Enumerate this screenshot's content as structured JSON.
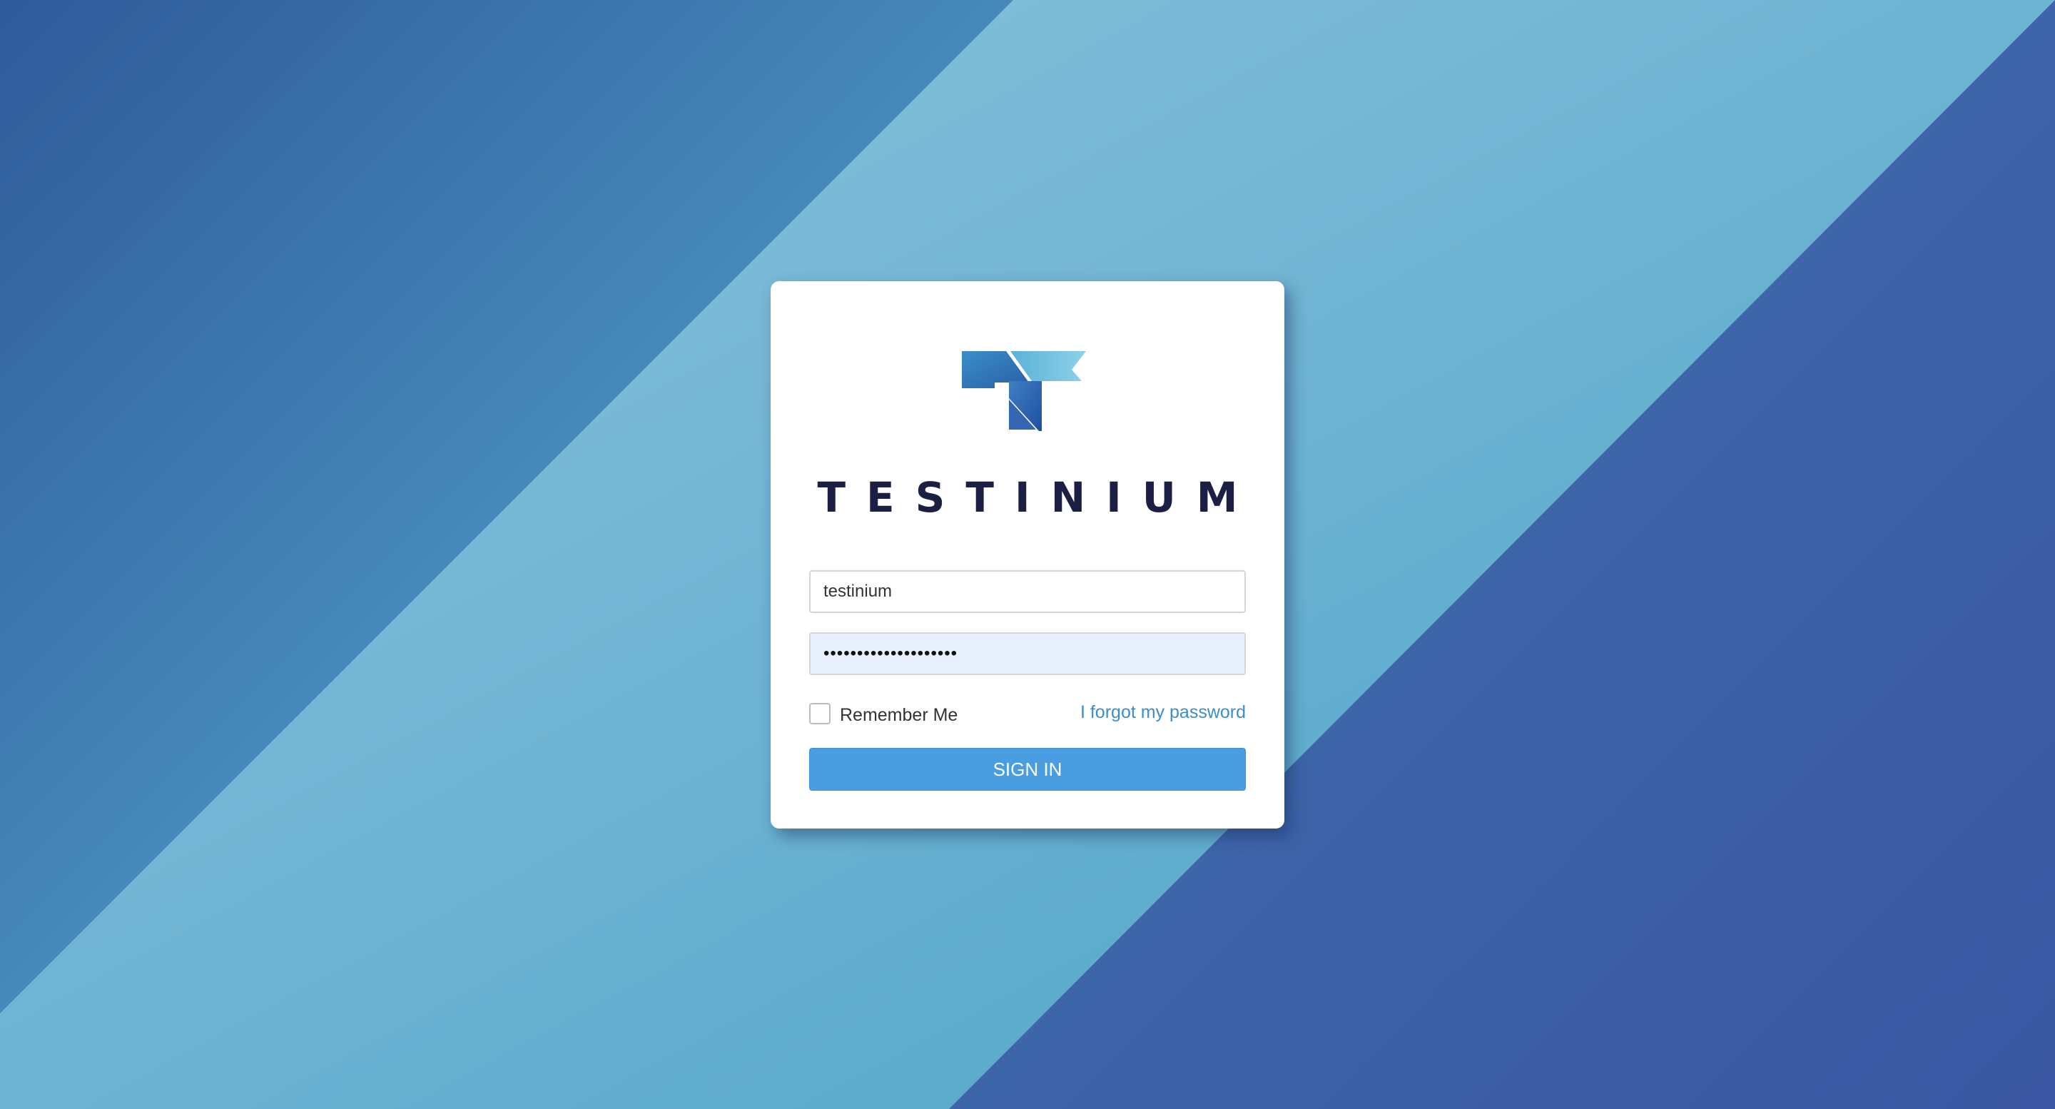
{
  "brand": {
    "name": "TESTINIUM",
    "logo_icon": "testinium-t-logo-icon"
  },
  "login": {
    "username_value": "testinium",
    "password_mask": "••••••••••••••••••••",
    "remember_label": "Remember Me",
    "remember_checked": false,
    "forgot_link": "I forgot my password",
    "sign_in_label": "SIGN IN"
  },
  "colors": {
    "background_dark": "#2f5a9a",
    "background_light": "#8ec6dc",
    "accent": "#4a9de0",
    "link": "#3c8dcc",
    "brand_text": "#1c1f44",
    "autofill_field": "#e8f0fe"
  }
}
